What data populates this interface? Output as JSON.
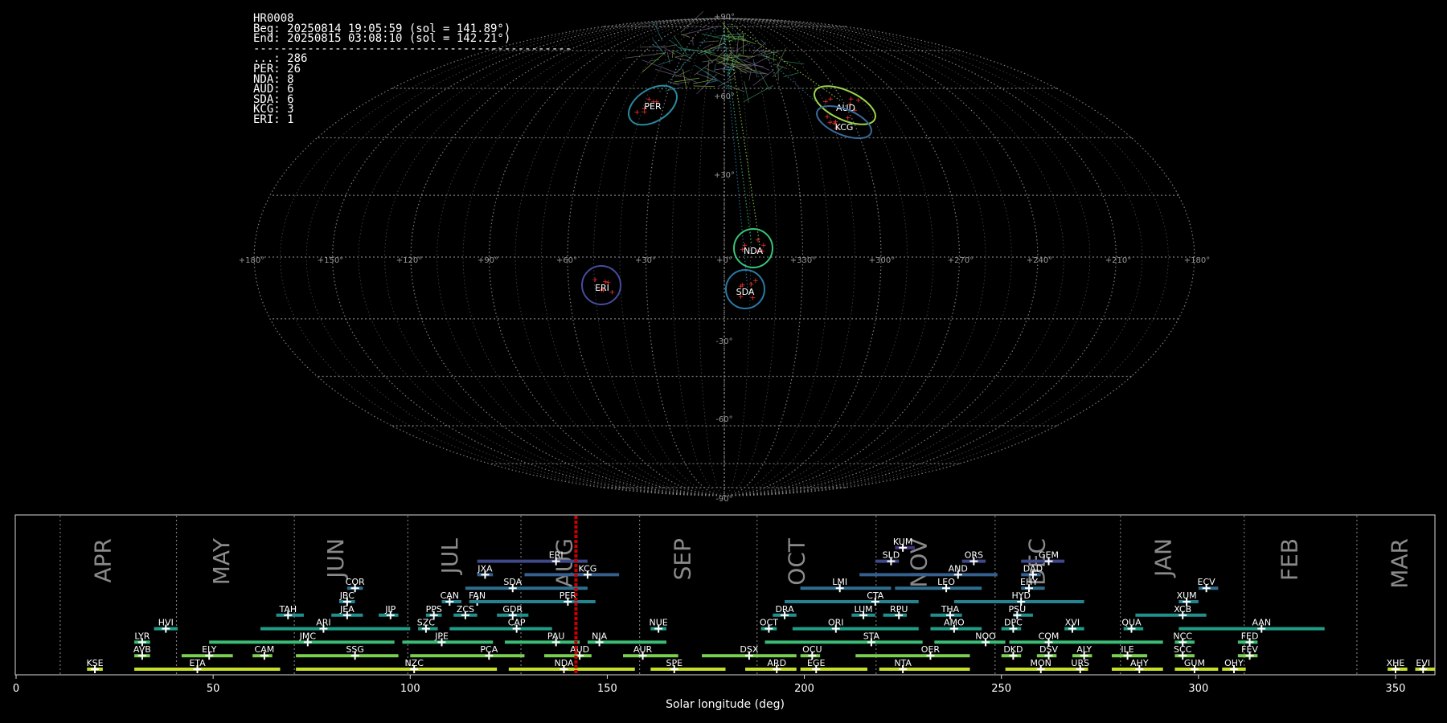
{
  "info": {
    "station": "HR0008",
    "begin": "Beg: 20250814 19:05:59 (sol = 141.89°)",
    "end": "End: 20250815 03:08:10 (sol = 142.21°)",
    "separator": "-----------------------------------------------",
    "counts": [
      {
        "code": "...",
        "count": 286
      },
      {
        "code": "PER",
        "count": 26
      },
      {
        "code": "NDA",
        "count": 8
      },
      {
        "code": "AUD",
        "count": 6
      },
      {
        "code": "SDA",
        "count": 6
      },
      {
        "code": "KCG",
        "count": 3
      },
      {
        "code": "ERI",
        "count": 1
      }
    ]
  },
  "sky_map": {
    "longitude_ticks": [
      "+180°",
      "+150°",
      "+120°",
      "+90°",
      "+60°",
      "+30°",
      "+0°",
      "+330°",
      "+300°",
      "+270°",
      "+240°",
      "+210°",
      "+180°"
    ],
    "latitude_labels": {
      "north_pole": "+90°",
      "south_pole": "-90°",
      "p60": "+60°",
      "p30": "+30°",
      "m30": "-30°",
      "m60": "-60°"
    },
    "radiants": [
      {
        "code": "PER",
        "color": "#2a8aa0"
      },
      {
        "code": "AUD",
        "color": "#9ad44a"
      },
      {
        "code": "KCG",
        "color": "#3a6a9a"
      },
      {
        "code": "NDA",
        "color": "#3ac47a"
      },
      {
        "code": "ERI",
        "color": "#4a4aa0"
      },
      {
        "code": "SDA",
        "color": "#2a7aa8"
      }
    ],
    "marker_color": "#ff3333",
    "grid_color": "#888888"
  },
  "chart_data": {
    "type": "timeline",
    "xlabel": "Solar longitude (deg)",
    "xlim": [
      0,
      360
    ],
    "xticks": [
      0,
      50,
      100,
      150,
      200,
      250,
      300,
      350
    ],
    "current_solar_longitude": 142.05,
    "current_marker_color": "#cc0000",
    "months": [
      {
        "name": "APR",
        "start": 11.2,
        "label_at": 24
      },
      {
        "name": "MAY",
        "start": 40.7,
        "label_at": 54
      },
      {
        "name": "JUN",
        "start": 70.6,
        "label_at": 83
      },
      {
        "name": "JUL",
        "start": 99.4,
        "label_at": 112
      },
      {
        "name": "AUG",
        "start": 128.1,
        "label_at": 141
      },
      {
        "name": "SEP",
        "start": 158.2,
        "label_at": 171
      },
      {
        "name": "OCT",
        "start": 188.0,
        "label_at": 200
      },
      {
        "name": "NOV",
        "start": 218.2,
        "label_at": 231
      },
      {
        "name": "DEC",
        "start": 248.4,
        "label_at": 261
      },
      {
        "name": "JAN",
        "start": 280.2,
        "label_at": 293
      },
      {
        "name": "FEB",
        "start": 311.6,
        "label_at": 325
      },
      {
        "name": "MAR",
        "start": 340.2,
        "label_at": 353
      }
    ],
    "showers": [
      {
        "code": "KUM",
        "start": 223,
        "end": 228,
        "peak": 225,
        "row": 9
      },
      {
        "code": "ERI",
        "start": 117,
        "end": 145,
        "peak": 137,
        "row": 8
      },
      {
        "code": "SLD",
        "start": 218,
        "end": 224,
        "peak": 222,
        "row": 8
      },
      {
        "code": "ORS",
        "start": 240,
        "end": 246,
        "peak": 243,
        "row": 8
      },
      {
        "code": "GEM",
        "start": 255,
        "end": 266,
        "peak": 262,
        "row": 8
      },
      {
        "code": "JXA",
        "start": 117,
        "end": 121,
        "peak": 119,
        "row": 7
      },
      {
        "code": "KCG",
        "start": 129,
        "end": 153,
        "peak": 145,
        "row": 7
      },
      {
        "code": "AND",
        "start": 214,
        "end": 249,
        "peak": 239,
        "row": 7
      },
      {
        "code": "DAD",
        "start": 255,
        "end": 260,
        "peak": 258,
        "row": 7
      },
      {
        "code": "COR",
        "start": 84,
        "end": 88,
        "peak": 86,
        "row": 6
      },
      {
        "code": "SDA",
        "start": 114,
        "end": 145,
        "peak": 126,
        "row": 6
      },
      {
        "code": "LMI",
        "start": 199,
        "end": 222,
        "peak": 209,
        "row": 6
      },
      {
        "code": "LEO",
        "start": 223,
        "end": 245,
        "peak": 236,
        "row": 6
      },
      {
        "code": "EHY",
        "start": 255,
        "end": 261,
        "peak": 257,
        "row": 6
      },
      {
        "code": "ECV",
        "start": 300,
        "end": 305,
        "peak": 302,
        "row": 6
      },
      {
        "code": "JBC",
        "start": 82,
        "end": 86,
        "peak": 84,
        "row": 5
      },
      {
        "code": "CAN",
        "start": 108,
        "end": 113,
        "peak": 110,
        "row": 5
      },
      {
        "code": "FAN",
        "start": 115,
        "end": 120,
        "peak": 117,
        "row": 5
      },
      {
        "code": "PER",
        "start": 115,
        "end": 147,
        "peak": 140,
        "row": 5
      },
      {
        "code": "CTA",
        "start": 195,
        "end": 229,
        "peak": 218,
        "row": 5
      },
      {
        "code": "HYD",
        "start": 238,
        "end": 271,
        "peak": 255,
        "row": 5
      },
      {
        "code": "XUM",
        "start": 295,
        "end": 300,
        "peak": 297,
        "row": 5
      },
      {
        "code": "TAH",
        "start": 66,
        "end": 73,
        "peak": 69,
        "row": 4
      },
      {
        "code": "JEA",
        "start": 80,
        "end": 88,
        "peak": 84,
        "row": 4
      },
      {
        "code": "JIP",
        "start": 92,
        "end": 97,
        "peak": 95,
        "row": 4
      },
      {
        "code": "PPS",
        "start": 104,
        "end": 108,
        "peak": 106,
        "row": 4
      },
      {
        "code": "ZCS",
        "start": 111,
        "end": 117,
        "peak": 114,
        "row": 4
      },
      {
        "code": "GDR",
        "start": 122,
        "end": 130,
        "peak": 126,
        "row": 4
      },
      {
        "code": "DRA",
        "start": 192,
        "end": 198,
        "peak": 195,
        "row": 4
      },
      {
        "code": "LUM",
        "start": 212,
        "end": 218,
        "peak": 215,
        "row": 4
      },
      {
        "code": "RPU",
        "start": 220,
        "end": 226,
        "peak": 224,
        "row": 4
      },
      {
        "code": "THA",
        "start": 232,
        "end": 240,
        "peak": 237,
        "row": 4
      },
      {
        "code": "PSU",
        "start": 253,
        "end": 258,
        "peak": 254,
        "row": 4
      },
      {
        "code": "XCB",
        "start": 284,
        "end": 302,
        "peak": 296,
        "row": 4
      },
      {
        "code": "HVI",
        "start": 35,
        "end": 41,
        "peak": 38,
        "row": 3
      },
      {
        "code": "ARI",
        "start": 62,
        "end": 100,
        "peak": 78,
        "row": 3
      },
      {
        "code": "SZC",
        "start": 102,
        "end": 107,
        "peak": 104,
        "row": 3
      },
      {
        "code": "CAP",
        "start": 110,
        "end": 136,
        "peak": 127,
        "row": 3
      },
      {
        "code": "NUE",
        "start": 161,
        "end": 165,
        "peak": 163,
        "row": 3
      },
      {
        "code": "OCT",
        "start": 189,
        "end": 193,
        "peak": 191,
        "row": 3
      },
      {
        "code": "ORI",
        "start": 197,
        "end": 229,
        "peak": 208,
        "row": 3
      },
      {
        "code": "AMO",
        "start": 232,
        "end": 245,
        "peak": 238,
        "row": 3
      },
      {
        "code": "DPC",
        "start": 250,
        "end": 255,
        "peak": 253,
        "row": 3
      },
      {
        "code": "XVI",
        "start": 266,
        "end": 271,
        "peak": 268,
        "row": 3
      },
      {
        "code": "QUA",
        "start": 281,
        "end": 286,
        "peak": 283,
        "row": 3
      },
      {
        "code": "AAN",
        "start": 295,
        "end": 332,
        "peak": 316,
        "row": 3
      },
      {
        "code": "LYR",
        "start": 30,
        "end": 34,
        "peak": 32,
        "row": 2
      },
      {
        "code": "JMC",
        "start": 49,
        "end": 96,
        "peak": 74,
        "row": 2
      },
      {
        "code": "JPE",
        "start": 98,
        "end": 121,
        "peak": 108,
        "row": 2
      },
      {
        "code": "PAU",
        "start": 124,
        "end": 143,
        "peak": 137,
        "row": 2
      },
      {
        "code": "NIA",
        "start": 145,
        "end": 165,
        "peak": 148,
        "row": 2
      },
      {
        "code": "STA",
        "start": 190,
        "end": 230,
        "peak": 217,
        "row": 2
      },
      {
        "code": "NOO",
        "start": 233,
        "end": 251,
        "peak": 246,
        "row": 2
      },
      {
        "code": "COM",
        "start": 252,
        "end": 291,
        "peak": 262,
        "row": 2
      },
      {
        "code": "NCC",
        "start": 294,
        "end": 299,
        "peak": 296,
        "row": 2
      },
      {
        "code": "FED",
        "start": 310,
        "end": 315,
        "peak": 313,
        "row": 2
      },
      {
        "code": "AVB",
        "start": 30,
        "end": 34,
        "peak": 32,
        "row": 1
      },
      {
        "code": "ELY",
        "start": 42,
        "end": 55,
        "peak": 49,
        "row": 1
      },
      {
        "code": "CAM",
        "start": 60,
        "end": 65,
        "peak": 63,
        "row": 1
      },
      {
        "code": "SSG",
        "start": 71,
        "end": 97,
        "peak": 86,
        "row": 1
      },
      {
        "code": "PCA",
        "start": 100,
        "end": 129,
        "peak": 120,
        "row": 1
      },
      {
        "code": "AUD",
        "start": 134,
        "end": 146,
        "peak": 143,
        "row": 1
      },
      {
        "code": "AUR",
        "start": 154,
        "end": 168,
        "peak": 159,
        "row": 1
      },
      {
        "code": "DSX",
        "start": 174,
        "end": 198,
        "peak": 186,
        "row": 1
      },
      {
        "code": "OCU",
        "start": 199,
        "end": 204,
        "peak": 202,
        "row": 1
      },
      {
        "code": "OER",
        "start": 213,
        "end": 242,
        "peak": 232,
        "row": 1
      },
      {
        "code": "DKD",
        "start": 250,
        "end": 255,
        "peak": 253,
        "row": 1
      },
      {
        "code": "DSV",
        "start": 259,
        "end": 264,
        "peak": 262,
        "row": 1
      },
      {
        "code": "ALY",
        "start": 268,
        "end": 273,
        "peak": 271,
        "row": 1
      },
      {
        "code": "ILE",
        "start": 278,
        "end": 287,
        "peak": 282,
        "row": 1
      },
      {
        "code": "SCC",
        "start": 294,
        "end": 299,
        "peak": 296,
        "row": 1
      },
      {
        "code": "FEV",
        "start": 310,
        "end": 315,
        "peak": 313,
        "row": 1
      },
      {
        "code": "KSE",
        "start": 18,
        "end": 22,
        "peak": 20,
        "row": 0
      },
      {
        "code": "ETA",
        "start": 30,
        "end": 67,
        "peak": 46,
        "row": 0
      },
      {
        "code": "NZC",
        "start": 71,
        "end": 122,
        "peak": 101,
        "row": 0
      },
      {
        "code": "NDA",
        "start": 125,
        "end": 157,
        "peak": 139,
        "row": 0
      },
      {
        "code": "SPE",
        "start": 161,
        "end": 180,
        "peak": 167,
        "row": 0
      },
      {
        "code": "ARD",
        "start": 185,
        "end": 198,
        "peak": 193,
        "row": 0
      },
      {
        "code": "EGE",
        "start": 199,
        "end": 216,
        "peak": 203,
        "row": 0
      },
      {
        "code": "NTA",
        "start": 219,
        "end": 242,
        "peak": 225,
        "row": 0
      },
      {
        "code": "MON",
        "start": 251,
        "end": 268,
        "peak": 260,
        "row": 0
      },
      {
        "code": "URS",
        "start": 268,
        "end": 272,
        "peak": 270,
        "row": 0
      },
      {
        "code": "AHY",
        "start": 278,
        "end": 291,
        "peak": 285,
        "row": 0
      },
      {
        "code": "GUM",
        "start": 294,
        "end": 305,
        "peak": 299,
        "row": 0
      },
      {
        "code": "OHY",
        "start": 306,
        "end": 312,
        "peak": 309,
        "row": 0
      },
      {
        "code": "XHE",
        "start": 348,
        "end": 353,
        "peak": 350,
        "row": 0
      },
      {
        "code": "EVI",
        "start": 355,
        "end": 360,
        "peak": 357,
        "row": 0
      }
    ],
    "row_colors": [
      "#c6e02a",
      "#7ad151",
      "#3bbb75",
      "#1f9e89",
      "#21908d",
      "#26828e",
      "#2e6e8e",
      "#355f8d",
      "#3f4889",
      "#46327e"
    ]
  }
}
